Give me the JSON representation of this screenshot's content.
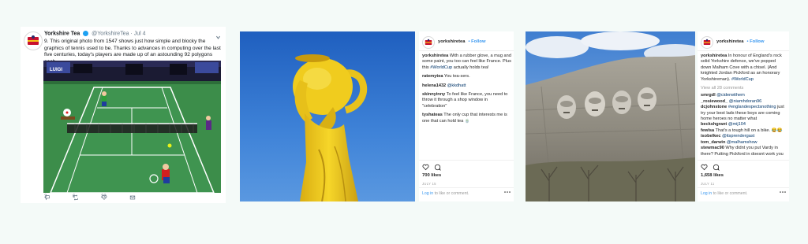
{
  "tweet": {
    "name": "Yorkshire Tea",
    "handle": "@YorkshireTea",
    "date": "· Jul 4",
    "text": "9. This original photo from 1547 shows just how simple and blocky the graphics of tennis used to be. Thanks to advances in computing over the last five centuries, today's players are made up of an astounding 92 polygons each.",
    "game_banner": "LUIGI",
    "replies": "3",
    "retweets": "6",
    "likes": "22"
  },
  "post1": {
    "username": "yorkshiretea",
    "follow": "• Follow",
    "caption_user": "yorkshiretea",
    "caption_text": " With a rubber glove, a mug and some paint, you too can feel like France. Plus this ",
    "caption_tag": "#WorldCup",
    "caption_tail": " actually holds tea!",
    "comments": [
      {
        "user": "ratemytea",
        "text": " You tea-sers."
      },
      {
        "user": "helena1432",
        "text": " ",
        "tag": "@kkdhatt"
      },
      {
        "user": "skinnyinny",
        "text": " To feel like France, you need to throw it through a shop window in \"celebration\""
      },
      {
        "user": "tyshateas",
        "text": " The only cup that interests me is one that can hold tea 🍵"
      }
    ],
    "likes": "700 likes",
    "date": "JULY 15",
    "login_link": "Log in",
    "login_rest": " to like or comment."
  },
  "post2": {
    "username": "yorkshiretea",
    "follow": "• Follow",
    "caption_user": "yorkshiretea",
    "caption_text": " In honour of England's rock solid Yorkshire defence, we've popped down Malham Cove with a chisel. (And knighted Jordan Pickford as an honorary Yorkshireman). ",
    "caption_tag": "#WorldCup",
    "view_all": "View all 28 comments",
    "comments": [
      {
        "user": "smrgdl",
        "text": " ",
        "tag": "@ciderwithem"
      },
      {
        "user": "_rosiewood_",
        "text": " ",
        "tag": "@niamhdoran96"
      },
      {
        "user": "dcjohnstone",
        "text": " ",
        "tag": "#englandexpectsnothing",
        "tail": " just try your best lads these boys are coming home heroes no matter what"
      },
      {
        "user": "beckshgrant",
        "text": " ",
        "tag": "@mij104"
      },
      {
        "user": "fewlsa",
        "text": " That's a tough hill on a bike. 😂😂"
      },
      {
        "user": "isobelkec",
        "text": " ",
        "tag": "@itsprendergast"
      },
      {
        "user": "tom_darwin",
        "text": " ",
        "tag": "@malhamshow"
      },
      {
        "user": "stewmac90",
        "text": " Why didnt you put Vardy in there? Putting Pickford in doesnt work you"
      }
    ],
    "likes": "1,658 likes",
    "date": "JULY 11",
    "login_link": "Log in",
    "login_rest": " to like or comment."
  },
  "colors": {
    "twitter_blue": "#1da1f2",
    "instagram_link": "#3897f0",
    "sky_blue": "#2f6fc7",
    "lemon_yellow": "#f3d11c",
    "court_green": "#3c8d4a"
  }
}
